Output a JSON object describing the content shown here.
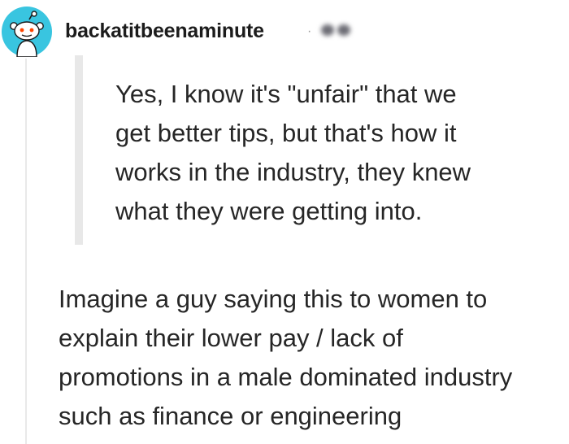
{
  "comment": {
    "avatar_icon": "snoo-avatar-icon",
    "avatar_color": "#39c5e0",
    "username": "backatitbeenaminute",
    "separator": "·",
    "quote": "Yes, I know it's \"unfair\" that we\nget better tips, but that's how it\nworks in the industry, they knew\nwhat they were getting into.",
    "body": "Imagine a guy saying this to women to\nexplain their lower pay / lack of\npromotions in a male dominated industry\nsuch as finance or engineering"
  }
}
